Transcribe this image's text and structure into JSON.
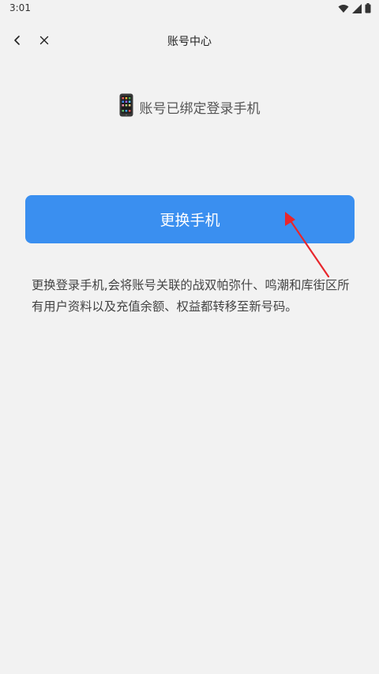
{
  "status_bar": {
    "time": "3:01",
    "icons": [
      "wifi-icon",
      "signal-icon",
      "battery-icon"
    ]
  },
  "nav": {
    "title": "账号中心",
    "back_icon": "chevron-left-icon",
    "close_icon": "close-icon"
  },
  "bound_info": {
    "icon": "mobile-phone-icon",
    "text": "账号已绑定登录手机"
  },
  "change_button": {
    "label": "更换手机"
  },
  "description": "更换登录手机,会将账号关联的战双帕弥什、鸣潮和库街区所有用户资料以及充值余额、权益都转移至新号码。",
  "colors": {
    "background": "#f2f2f2",
    "button": "#3a8ff0",
    "annotation_arrow": "#e8262c"
  }
}
